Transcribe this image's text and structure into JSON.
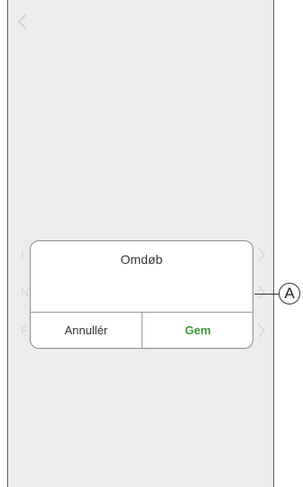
{
  "background_rows": [
    {
      "label": "I"
    },
    {
      "label": "N"
    },
    {
      "label": "F"
    }
  ],
  "dialog": {
    "title": "Omdøb",
    "cancel_label": "Annullér",
    "save_label": "Gem"
  },
  "callout": {
    "label": "A"
  },
  "colors": {
    "save_accent": "#3a9a3a",
    "screen_background": "#ececec",
    "dialog_background": "#ffffff"
  }
}
